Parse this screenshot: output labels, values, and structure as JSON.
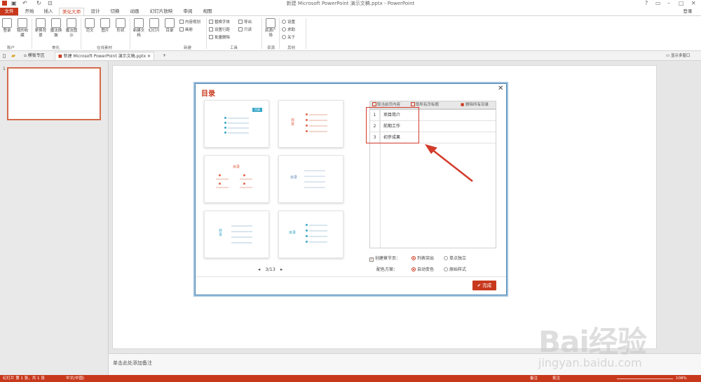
{
  "window": {
    "title": "新建 Microsoft PowerPoint 演示文稿.pptx - PowerPoint",
    "login": "登录"
  },
  "tabs": [
    "文件",
    "开始",
    "插入",
    "美化大师",
    "设计",
    "切换",
    "动画",
    "幻灯片放映",
    "审阅",
    "视图"
  ],
  "ribbon": {
    "account": {
      "login": "登录",
      "favorites": "我的收藏",
      "group": "账户"
    },
    "beautify": {
      "change_bg": "更换背景",
      "magic_replace": "魔法换裝",
      "magic_chart": "魔法图示",
      "group": "美化"
    },
    "online": {
      "text": "范文",
      "image": "图片",
      "shape": "形状",
      "group": "在线素材"
    },
    "new": {
      "new_doc": "新建文档",
      "slide": "幻灯片",
      "toc": "目录",
      "content_plan": "内容规划",
      "canvas": "画册",
      "group": "新建"
    },
    "tools": {
      "replace_font": "替换字体",
      "set_spacing": "设置行距",
      "batch_delete": "批量删除",
      "export": "导出",
      "read_only": "只读",
      "group": "工具"
    },
    "resources": {
      "plaza": "资源广场",
      "group": "资源"
    },
    "other": {
      "settings": "设置",
      "help": "求助",
      "about": "关于",
      "group": "其他"
    }
  },
  "doc_tabs": {
    "template_zone": "模板专区",
    "doc": "新建 Microsoft PowerPoint 演示文稿.pptx",
    "show_multi": "显示多窗口"
  },
  "slide_pane": {
    "number": "1"
  },
  "notes": {
    "placeholder": "单击此处添加备注"
  },
  "status": {
    "slide_info": "幻灯片 第 1 张，共 1 张",
    "lang": "中文(中国)",
    "notes": "备注",
    "comments": "批注",
    "zoom": "108%"
  },
  "dialog": {
    "title": "目录",
    "templates": [
      {
        "heading": "目录"
      },
      {
        "heading": "目录"
      },
      {
        "heading": "目录"
      },
      {
        "heading": "目录"
      },
      {
        "heading": "目录"
      },
      {
        "heading": "目录"
      }
    ],
    "pager": {
      "text": "3/13",
      "prev": "◂",
      "next": "▸"
    },
    "toolbar": {
      "fetch_current": "取当前页内容",
      "fetch_all": "取所有页标题",
      "delete_all": "删除所有目录"
    },
    "toc_items": [
      {
        "num": "1",
        "text": "项目简介"
      },
      {
        "num": "2",
        "text": "前期工作"
      },
      {
        "num": "3",
        "text": "初步成果"
      }
    ],
    "options": {
      "create_section_label": "创建章节页：",
      "list_highlight": "列表突出",
      "single_page": "单点独立",
      "color_label": "配色方案：",
      "auto_color": "自动变色",
      "original_style": "原始样式"
    },
    "done": "完成",
    "colors": {
      "accent": "#c8381c",
      "teal": "#3aa8c8"
    }
  },
  "watermark": {
    "text": "Bai经验",
    "url": "jingyan.baidu.com"
  }
}
